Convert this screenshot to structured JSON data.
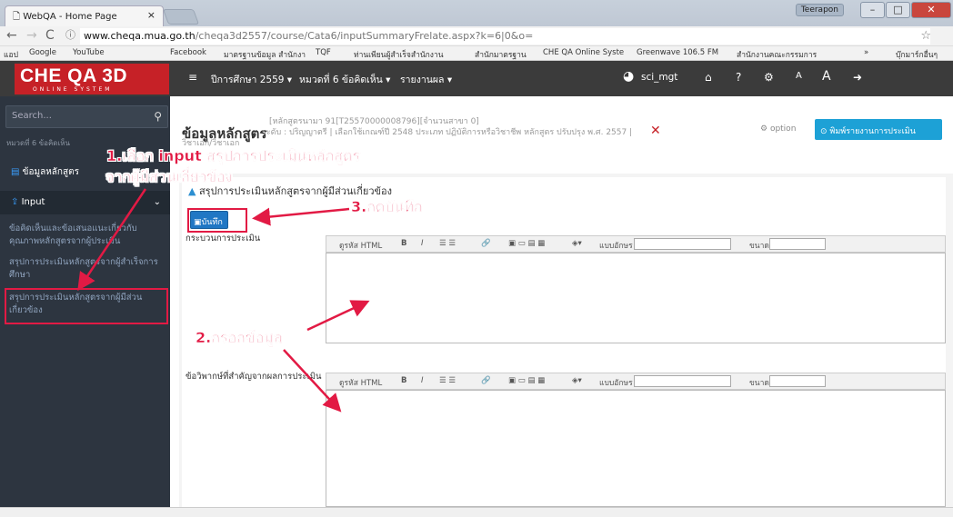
{
  "browser": {
    "tab_title": "WebQA - Home Page",
    "tab_close": "×",
    "window_user": "Teerapon",
    "url_host": "www.cheqa.mua.go.th",
    "url_path": "/cheqa3d2557/course/Cata6/inputSummaryFrelate.aspx?k=6|0&o=",
    "bookmarks": [
      "แอป",
      "Google",
      "YouTube",
      "Facebook",
      "มาตรฐานข้อมูล สำนักงา",
      "TQF",
      "ท่านเพียนผู้สำเร็จสำนักงาน",
      "สำนักมาตรฐาน",
      "CHE QA Online Syste",
      "Greenwave 106.5 FM",
      "สำนักงานคณะกรรมการ",
      "»",
      "บุ๊กมาร์กอื่นๆ"
    ]
  },
  "app": {
    "logo_main": "CHE QA 3D",
    "logo_sub": "ONLINE SYSTEM",
    "menu": [
      "ปีการศึกษา 2559 ▾",
      "หมวดที่ 6 ข้อคิดเห็น ▾",
      "รายงานผล ▾"
    ],
    "username": "sci_mgt"
  },
  "sidebar": {
    "search_placeholder": "Search...",
    "sub_label": "หมวดที่ 6 ข้อคิดเห็น",
    "item_course": "ข้อมูลหลักสูตร",
    "item_input": "Input",
    "links": [
      "ข้อคิดเห็นและข้อเสนอแนะเกี่ยวกับคุณภาพหลักสูตรจากผู้ประเมิน",
      "สรุปการประเมินหลักสูตรจากผู้สำเร็จการศึกษา",
      "สรุปการประเมินหลักสูตรจากผู้มีส่วนเกี่ยวข้อง"
    ]
  },
  "page": {
    "title": "ข้อมูลหลักสูตร",
    "meta_line1": "[หลักสูตรนามา 91[T25570000008796][จำนวนสาขา 0]",
    "meta_line2": "ระดับ : ปริญญาตรี | เลือกใช้เกณฑ์ปี 2548 ประเภท ปฏิบัติการหรือวิชาชีพ หลักสูตร ปรับปรุง พ.ศ. 2557 |",
    "meta_line3": "วิชาเอก/วิชาเอก",
    "option": "option",
    "print_button": "พิมพ์รายงานการประเมินตนเอง",
    "section_title": "สรุปการประเมินหลักสูตรจากผู้มีส่วนเกี่ยวข้อง",
    "save_button": "บันทึก",
    "field1_label": "กระบวนการประเมิน",
    "field2_label": "ข้อวิพากษ์ที่สำคัญจากผลการประเมิน",
    "toolbar": {
      "html": "ดูรหัส HTML",
      "bold": "B",
      "italic": "I",
      "font": "แบบอักษร",
      "size": "ขนาด"
    }
  },
  "annotations": {
    "a1_line1": "1.เลือก input สรุปการประเมินหลักสูตร",
    "a1_line2": "จากผู้มีส่วนเกี่ยวข้อง",
    "a2": "2.กรอกข้อมูล",
    "a3": "3.กดบันทึก"
  },
  "colors": {
    "brand_red": "#c62127",
    "annotation": "#e21a44",
    "sidebar": "#2d3540",
    "print_button": "#1da1d6"
  }
}
